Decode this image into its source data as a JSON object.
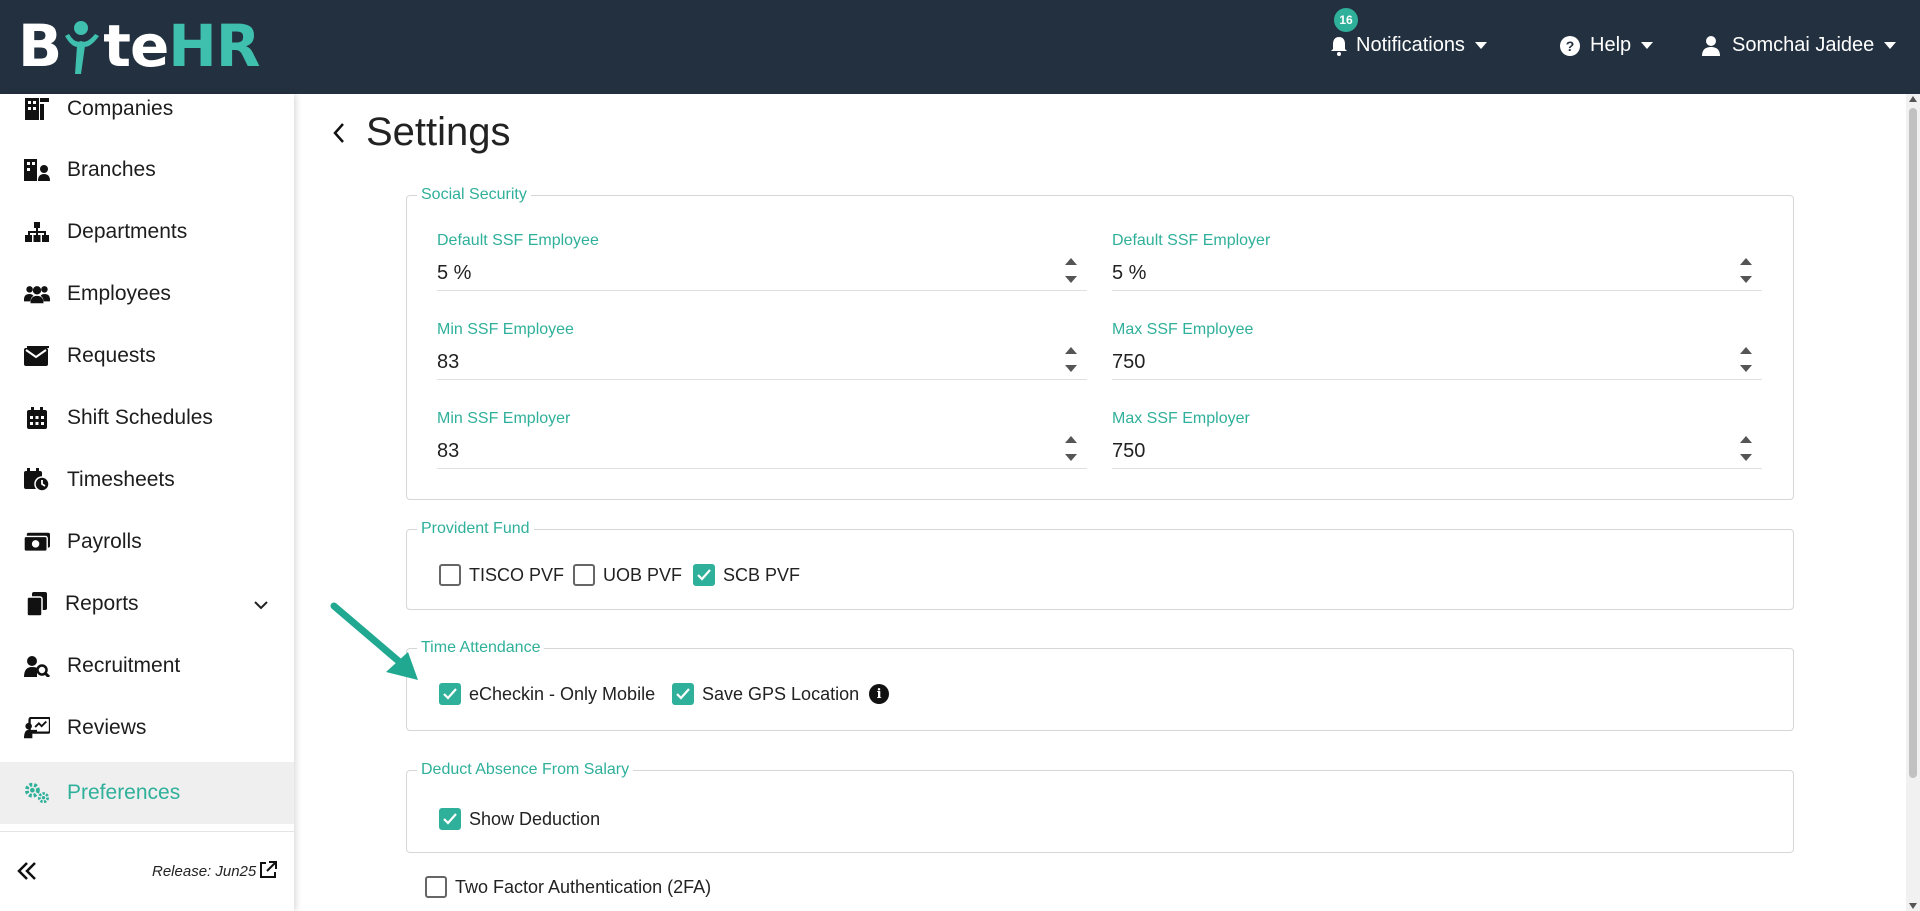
{
  "brand": {
    "part1": "B",
    "part2": "te",
    "part3": "HR",
    "colors": {
      "topbar": "#23303f",
      "accent": "#2fb09a"
    }
  },
  "topnav": {
    "notifications": {
      "label": "Notifications",
      "count": "16",
      "icon": "bell-icon"
    },
    "help": {
      "label": "Help",
      "icon": "question-circle-icon"
    },
    "user": {
      "label": "Somchai Jaidee",
      "icon": "user-icon"
    }
  },
  "sidebar": {
    "items": [
      {
        "label": "Companies",
        "icon": "building-icon"
      },
      {
        "label": "Branches",
        "icon": "branches-icon"
      },
      {
        "label": "Departments",
        "icon": "sitemap-icon"
      },
      {
        "label": "Employees",
        "icon": "users-icon"
      },
      {
        "label": "Requests",
        "icon": "envelope-icon"
      },
      {
        "label": "Shift Schedules",
        "icon": "calendar-icon"
      },
      {
        "label": "Timesheets",
        "icon": "calendar-clock-icon"
      },
      {
        "label": "Payrolls",
        "icon": "money-icon"
      },
      {
        "label": "Reports",
        "icon": "copy-icon"
      },
      {
        "label": "Recruitment",
        "icon": "user-search-icon"
      },
      {
        "label": "Reviews",
        "icon": "chalkboard-icon"
      },
      {
        "label": "Preferences",
        "icon": "gears-icon",
        "active": true
      }
    ],
    "release": "Release: Jun25"
  },
  "page": {
    "title": "Settings"
  },
  "social_security": {
    "legend": "Social Security",
    "fields": [
      {
        "label": "Default SSF Employee",
        "value": "5 %"
      },
      {
        "label": "Default SSF Employer",
        "value": "5 %"
      },
      {
        "label": "Min SSF Employee",
        "value": "83"
      },
      {
        "label": "Max SSF Employee",
        "value": "750"
      },
      {
        "label": "Min SSF Employer",
        "value": "83"
      },
      {
        "label": "Max SSF Employer",
        "value": "750"
      }
    ]
  },
  "provident_fund": {
    "legend": "Provident Fund",
    "options": [
      {
        "label": "TISCO PVF",
        "checked": false
      },
      {
        "label": "UOB PVF",
        "checked": false
      },
      {
        "label": "SCB PVF",
        "checked": true
      }
    ]
  },
  "time_attendance": {
    "legend": "Time Attendance",
    "options": [
      {
        "label": "eCheckin - Only Mobile",
        "checked": true
      },
      {
        "label": "Save GPS Location",
        "checked": true
      }
    ]
  },
  "deduct_absence": {
    "legend": "Deduct Absence From Salary",
    "options": [
      {
        "label": "Show Deduction",
        "checked": true
      }
    ]
  },
  "two_factor": {
    "label": "Two Factor Authentication (2FA)",
    "checked": false
  }
}
